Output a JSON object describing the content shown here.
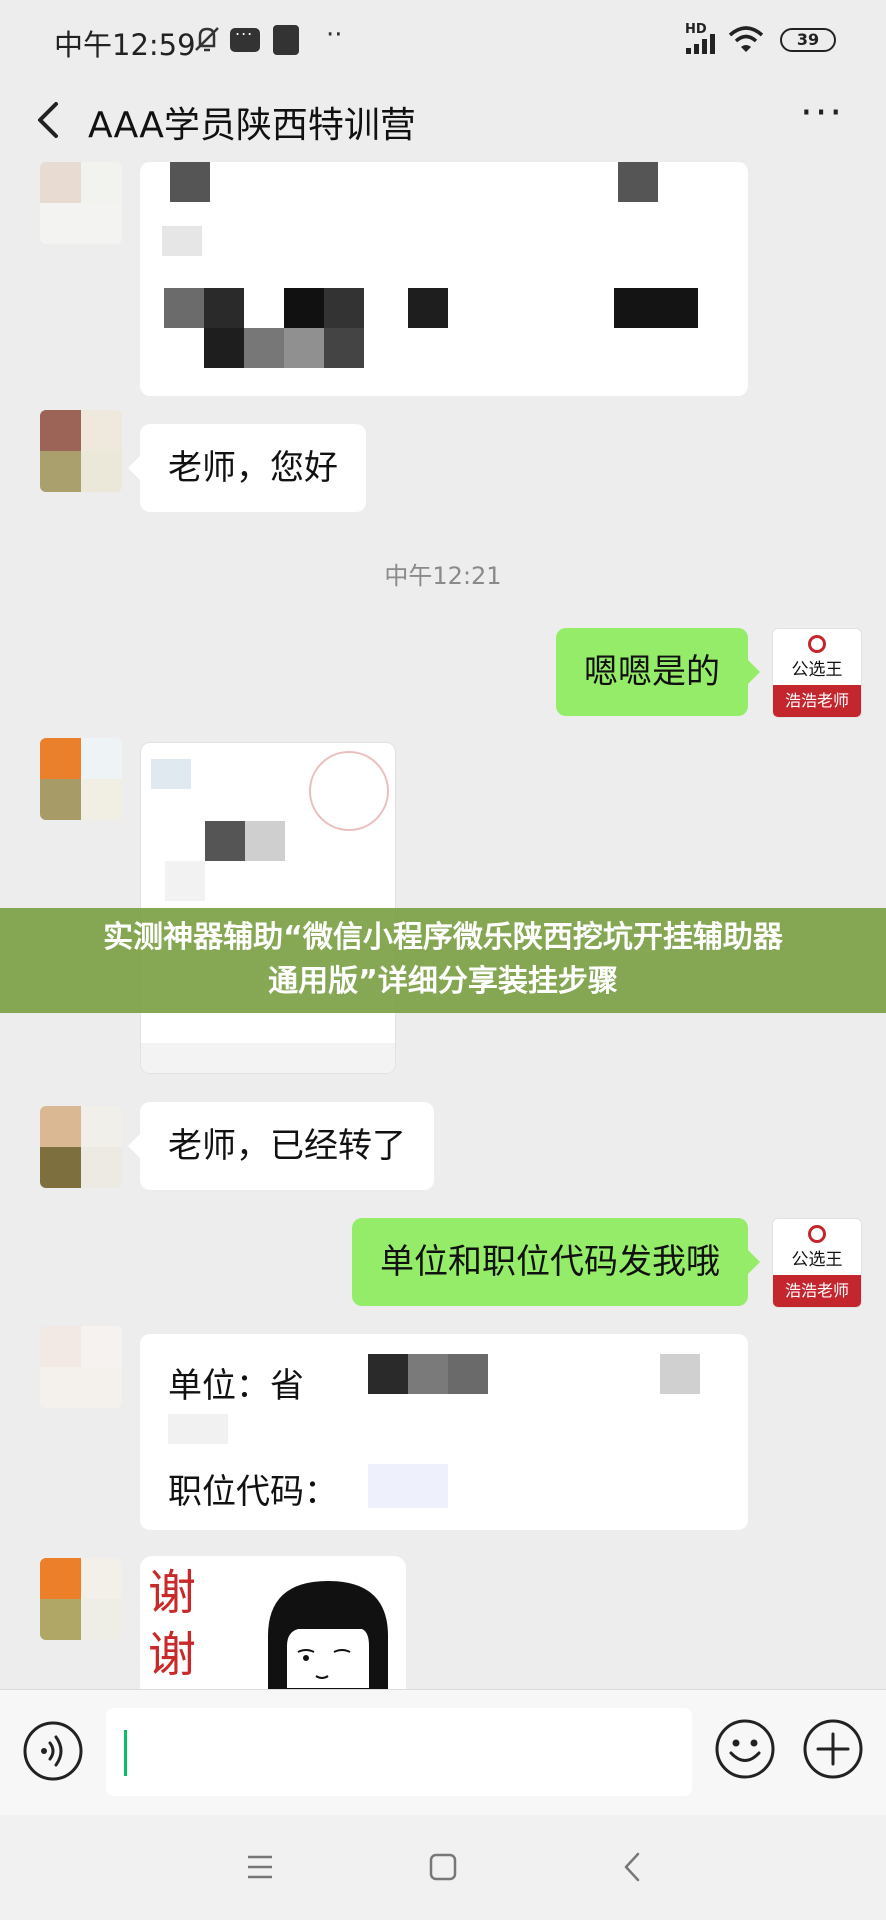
{
  "status_bar": {
    "time": "中午12:59",
    "network": "HD",
    "battery": "39",
    "icons": [
      "mute-icon",
      "message-icon",
      "app-icon",
      "more-dots-icon",
      "signal-icon",
      "wifi-icon",
      "battery-icon"
    ]
  },
  "nav": {
    "title": "AAA学员陕西特训营",
    "back_icon": "chevron-left-icon",
    "more_icon": "more-horizontal-icon"
  },
  "messages": {
    "hello": "老师，您好",
    "timestamp": "中午12:21",
    "reply_yes": "嗯嗯是的",
    "transferred": "老师，已经转了",
    "ask_code": "单位和职位代码发我哦",
    "info_unit_label": "单位：省",
    "info_code_label": "职位代码：",
    "sticker_text_1": "谢",
    "sticker_text_2": "谢"
  },
  "my_avatar": {
    "brand": "公选王",
    "tag": "浩浩老师"
  },
  "banner": {
    "line1": "实测神器辅助“微信小程序微乐陕西挖坑开挂辅助器",
    "line2": "通用版”详细分享装挂步骤"
  },
  "input_bar": {
    "value": "",
    "placeholder": "",
    "voice_icon": "voice-icon",
    "emoji_icon": "emoji-icon",
    "plus_icon": "plus-circle-icon"
  },
  "system_nav": {
    "icons": [
      "menu-icon",
      "home-icon",
      "back-icon"
    ]
  },
  "colors": {
    "background": "#ededed",
    "my_bubble": "#95ec69",
    "other_bubble": "#ffffff",
    "brand_red": "#c4262e",
    "banner": "#7da046"
  }
}
